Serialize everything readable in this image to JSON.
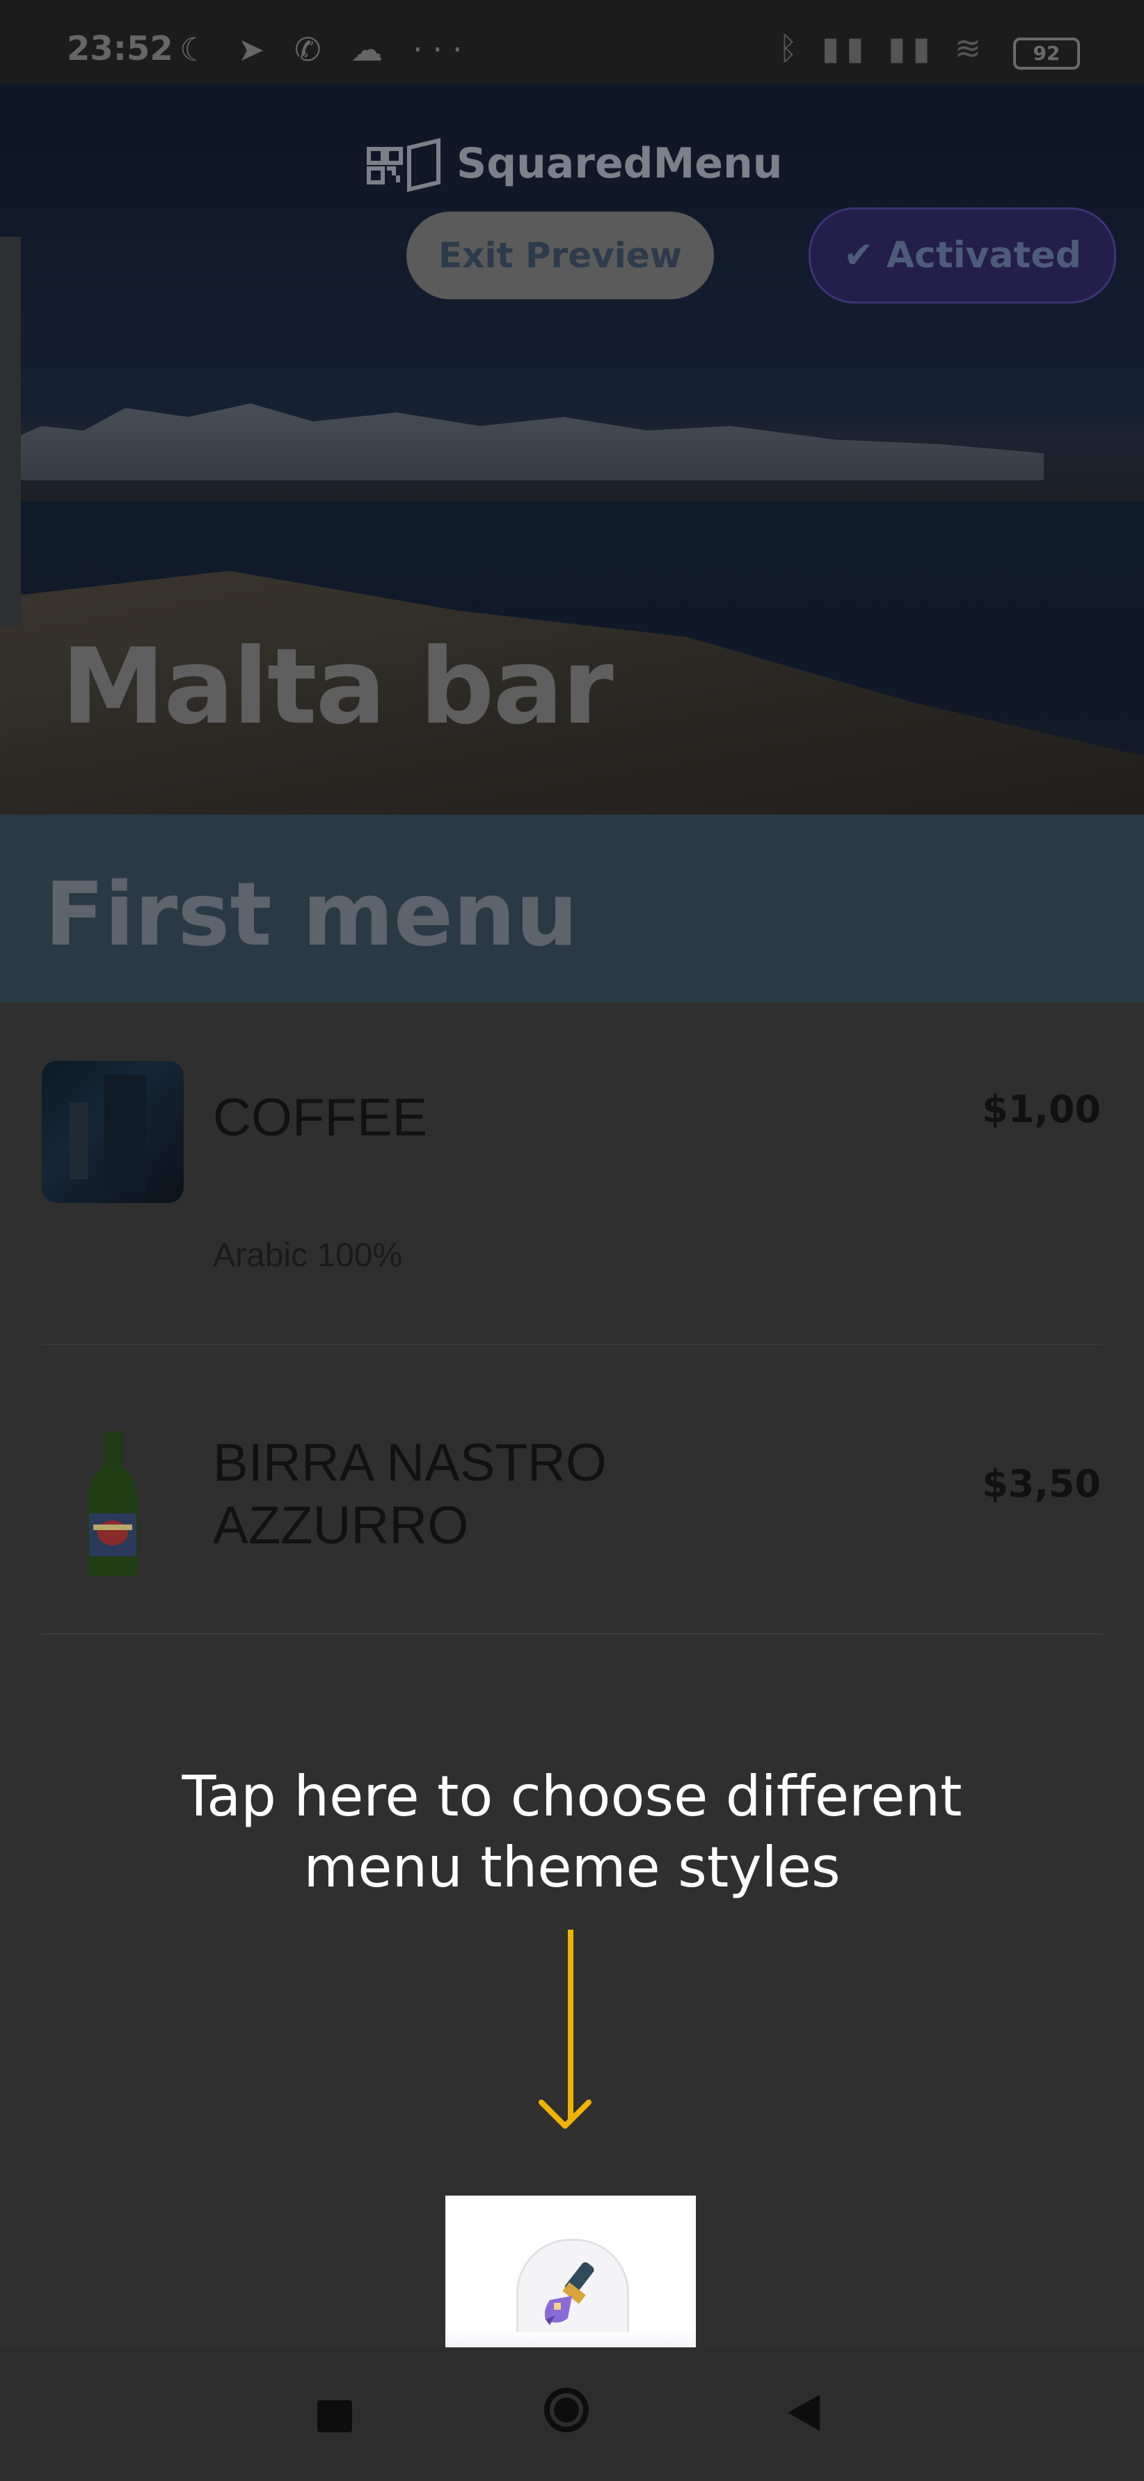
{
  "status_bar": {
    "time": "23:52",
    "left_icons": "☾ ➤ ✆ ☁ ···",
    "right_icons": "ᛒ ▮▮ ▮▮ ≋",
    "battery": "92"
  },
  "header": {
    "logo_text": "SquaredMenu",
    "exit_preview_label": "Exit Preview",
    "activated_label": "✔ Activated",
    "venue_name": "Malta bar"
  },
  "menu": {
    "title": "First menu",
    "items": [
      {
        "name": "COFFEE",
        "price": "$1,00",
        "description": "Arabic 100%"
      },
      {
        "name_line1": "BIRRA NASTRO",
        "name_line2": "AZZURRO",
        "price": "$3,50"
      }
    ]
  },
  "onboarding": {
    "hint_line1": "Tap here to choose different",
    "hint_line2": "menu theme styles",
    "accent_color": "#f0b400"
  },
  "theme_button": {
    "icon": "paintbrush-icon"
  },
  "nav_bar": {
    "icons": [
      "recent-apps-icon",
      "home-icon",
      "back-icon"
    ]
  }
}
